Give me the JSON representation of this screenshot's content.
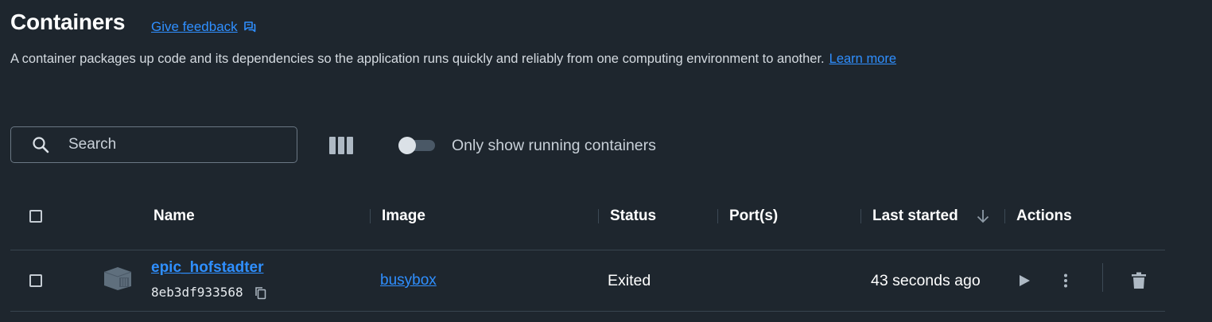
{
  "header": {
    "title": "Containers",
    "feedback_label": "Give feedback",
    "description": "A container packages up code and its dependencies so the application runs quickly and reliably from one computing environment to another.",
    "learn_more": "Learn more"
  },
  "toolbar": {
    "search_placeholder": "Search",
    "running_toggle_label": "Only show running containers",
    "running_toggle_on": false
  },
  "table": {
    "columns": [
      "Name",
      "Image",
      "Status",
      "Port(s)",
      "Last started",
      "Actions"
    ],
    "sort_column": "Last started",
    "sort_direction": "descending",
    "rows": [
      {
        "name": "epic_hofstadter",
        "id": "8eb3df933568",
        "image": "busybox",
        "status": "Exited",
        "ports": "",
        "last_started": "43 seconds ago"
      }
    ]
  },
  "icons": {
    "feedback": "chat-icon",
    "search": "search-icon",
    "columns": "columns-icon",
    "sort": "arrow-down-icon",
    "copy": "copy-icon",
    "container": "container-icon",
    "play": "play-icon",
    "more": "more-vertical-icon",
    "delete": "trash-icon"
  },
  "colors": {
    "background": "#1e262e",
    "link": "#2f8fff",
    "text": "#ffffff"
  }
}
